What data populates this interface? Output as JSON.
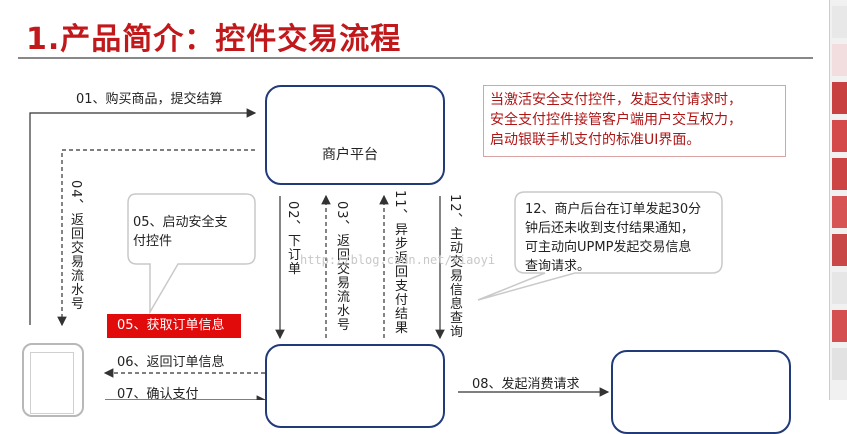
{
  "title": "1.产品简介：控件交易流程",
  "nodes": {
    "merchant_platform": "商户平台"
  },
  "note": {
    "lines": [
      "当激活安全支付控件，发起支付请求时，",
      "安全支付控件接管客户端用户交互权力，",
      "启动银联手机支付的标准UI界面。"
    ]
  },
  "bubbles": {
    "left": [
      "05、启动安全支",
      "付控件"
    ],
    "right": [
      "12、商户后台在订单发起30分",
      "钟后还未收到支付结果通知，",
      "可主动向UPMP发起交易信息",
      "查询请求。"
    ]
  },
  "steps": {
    "s01": "01、购买商品，提交结算",
    "s04": "04、返回交易流水号",
    "s02": "02、下订单",
    "s03": "03、返回交易流水号",
    "s11": "11、异步返回支付结果",
    "s12": "12、主动交易信息查询",
    "s05": "05、获取订单信息",
    "s06": "06、返回订单信息",
    "s07": "07、确认支付",
    "s08": "08、发起消费请求"
  },
  "watermark": "http://blog.csdn.net/xiaoyi",
  "colors": {
    "title": "#c0181b",
    "node_border": "#203a7a",
    "note_text": "#b01515",
    "highlight_step": "#e20b0b"
  }
}
